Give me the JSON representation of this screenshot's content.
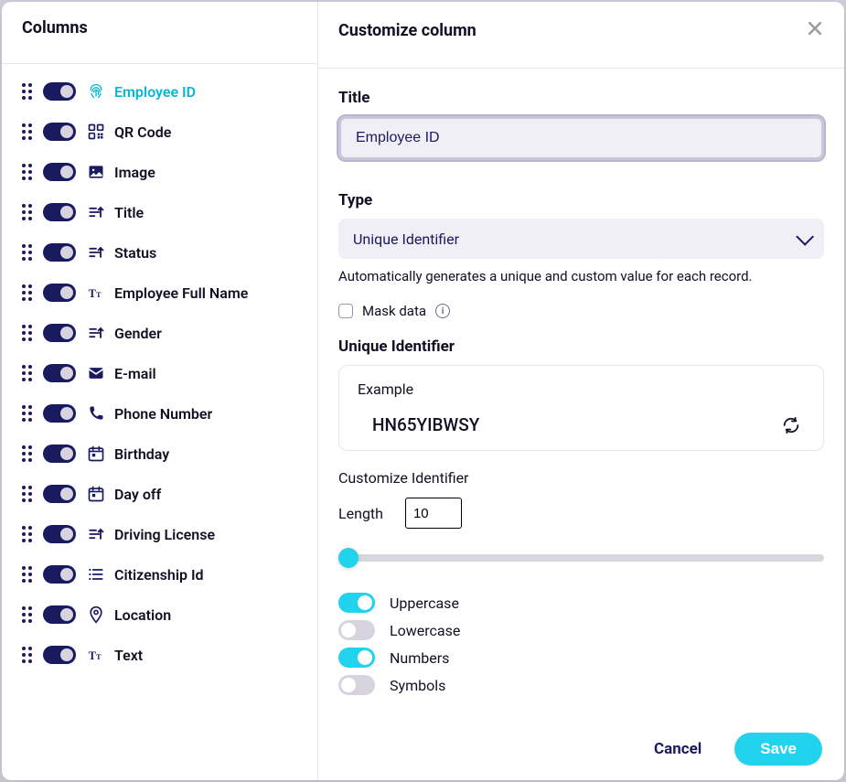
{
  "sidebar": {
    "heading": "Columns",
    "items": [
      {
        "label": "Employee ID",
        "icon": "fingerprint-icon",
        "on": true,
        "selected": true
      },
      {
        "label": "QR Code",
        "icon": "qr-code-icon",
        "on": true,
        "selected": false
      },
      {
        "label": "Image",
        "icon": "image-icon",
        "on": true,
        "selected": false
      },
      {
        "label": "Title",
        "icon": "sort-icon",
        "on": true,
        "selected": false
      },
      {
        "label": "Status",
        "icon": "sort-icon",
        "on": true,
        "selected": false
      },
      {
        "label": "Employee Full Name",
        "icon": "text-icon",
        "on": true,
        "selected": false
      },
      {
        "label": "Gender",
        "icon": "sort-icon",
        "on": true,
        "selected": false
      },
      {
        "label": "E-mail",
        "icon": "mail-icon",
        "on": true,
        "selected": false
      },
      {
        "label": "Phone Number",
        "icon": "phone-icon",
        "on": true,
        "selected": false
      },
      {
        "label": "Birthday",
        "icon": "calendar-icon",
        "on": true,
        "selected": false
      },
      {
        "label": "Day off",
        "icon": "calendar-icon",
        "on": true,
        "selected": false
      },
      {
        "label": "Driving License",
        "icon": "sort-icon",
        "on": true,
        "selected": false
      },
      {
        "label": "Citizenship Id",
        "icon": "list-icon",
        "on": true,
        "selected": false
      },
      {
        "label": "Location",
        "icon": "location-icon",
        "on": true,
        "selected": false
      },
      {
        "label": "Text",
        "icon": "text-icon",
        "on": true,
        "selected": false
      }
    ]
  },
  "panel": {
    "heading": "Customize column",
    "title_label": "Title",
    "title_value": "Employee ID",
    "type_label": "Type",
    "type_value": "Unique Identifier",
    "type_desc": "Automatically generates a unique and custom value for each record.",
    "mask_label": "Mask data",
    "uid_heading": "Unique Identifier",
    "example_label": "Example",
    "example_value": "HN65YIBWSY",
    "customize_label": "Customize Identifier",
    "length_label": "Length",
    "length_value": "10",
    "options": [
      {
        "label": "Uppercase",
        "on": true
      },
      {
        "label": "Lowercase",
        "on": false
      },
      {
        "label": "Numbers",
        "on": true
      },
      {
        "label": "Symbols",
        "on": false
      }
    ],
    "cancel": "Cancel",
    "save": "Save"
  }
}
